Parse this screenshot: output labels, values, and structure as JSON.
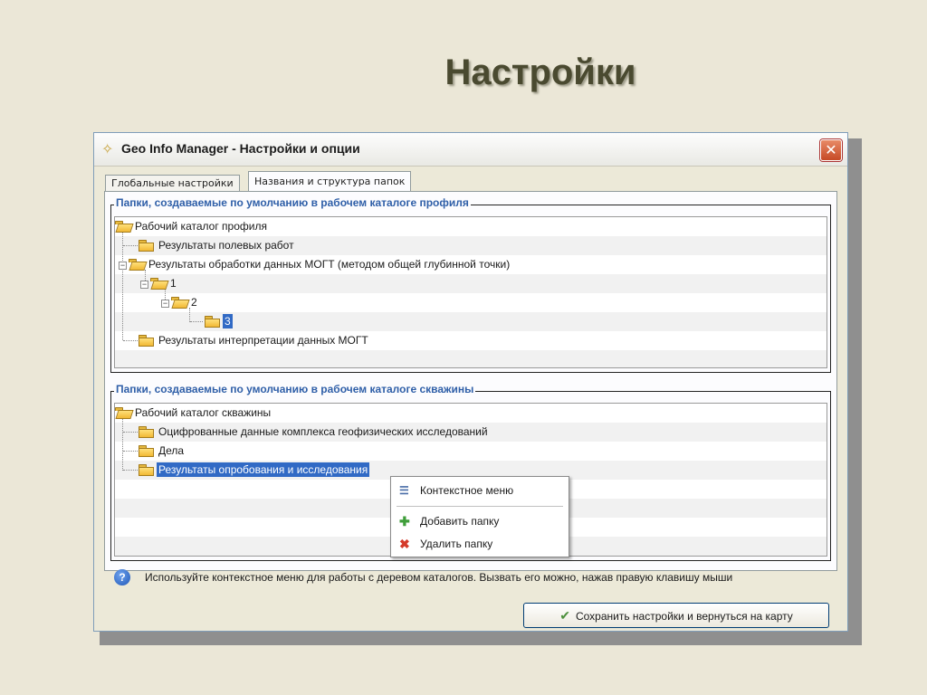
{
  "slide": {
    "title": "Настройки"
  },
  "window": {
    "title": "Geo Info Manager - Настройки и опции",
    "close_symbol": "✕"
  },
  "tabs": [
    {
      "label": "Глобальные настройки",
      "active": false
    },
    {
      "label": "Названия  и структура папок",
      "active": true
    }
  ],
  "group_profile": {
    "legend": "Папки, создаваемые по умолчанию в рабочем каталоге профиля",
    "nodes": [
      {
        "label": "Рабочий каталог профиля"
      },
      {
        "label": "Результаты полевых работ"
      },
      {
        "label": "Результаты обработки данных МОГТ (методом общей глубинной точки)"
      },
      {
        "label": "1"
      },
      {
        "label": "2"
      },
      {
        "label": "3",
        "selected": true
      },
      {
        "label": "Результаты интерпретации данных МОГТ"
      }
    ]
  },
  "group_well": {
    "legend": "Папки, создаваемые по умолчанию в рабочем каталоге скважины",
    "nodes": [
      {
        "label": "Рабочий каталог скважины"
      },
      {
        "label": "Оцифрованные данные комплекса геофизических исследований"
      },
      {
        "label": "Дела"
      },
      {
        "label": "Результаты опробования и исследования",
        "selected": true
      }
    ]
  },
  "context_menu": {
    "header": "Контекстное меню",
    "add": "Добавить папку",
    "delete": "Удалить папку"
  },
  "hint": {
    "icon": "?",
    "text": "Используйте контекстное меню для работы с деревом каталогов. Вызвать его можно, нажав правую клавишу мыши"
  },
  "save_button": {
    "label": "Сохранить настройки и вернуться на карту"
  },
  "icons": {
    "window": "compass-star-icon",
    "folder": "folder-icon",
    "help": "help-icon",
    "save": "save-check-icon",
    "menu": "menu-list-icon",
    "add": "plus-icon",
    "delete": "delete-x-icon"
  },
  "colors": {
    "selection": "#316ac5",
    "legend_text": "#2f5fa8",
    "close_button": "#c64a26"
  }
}
